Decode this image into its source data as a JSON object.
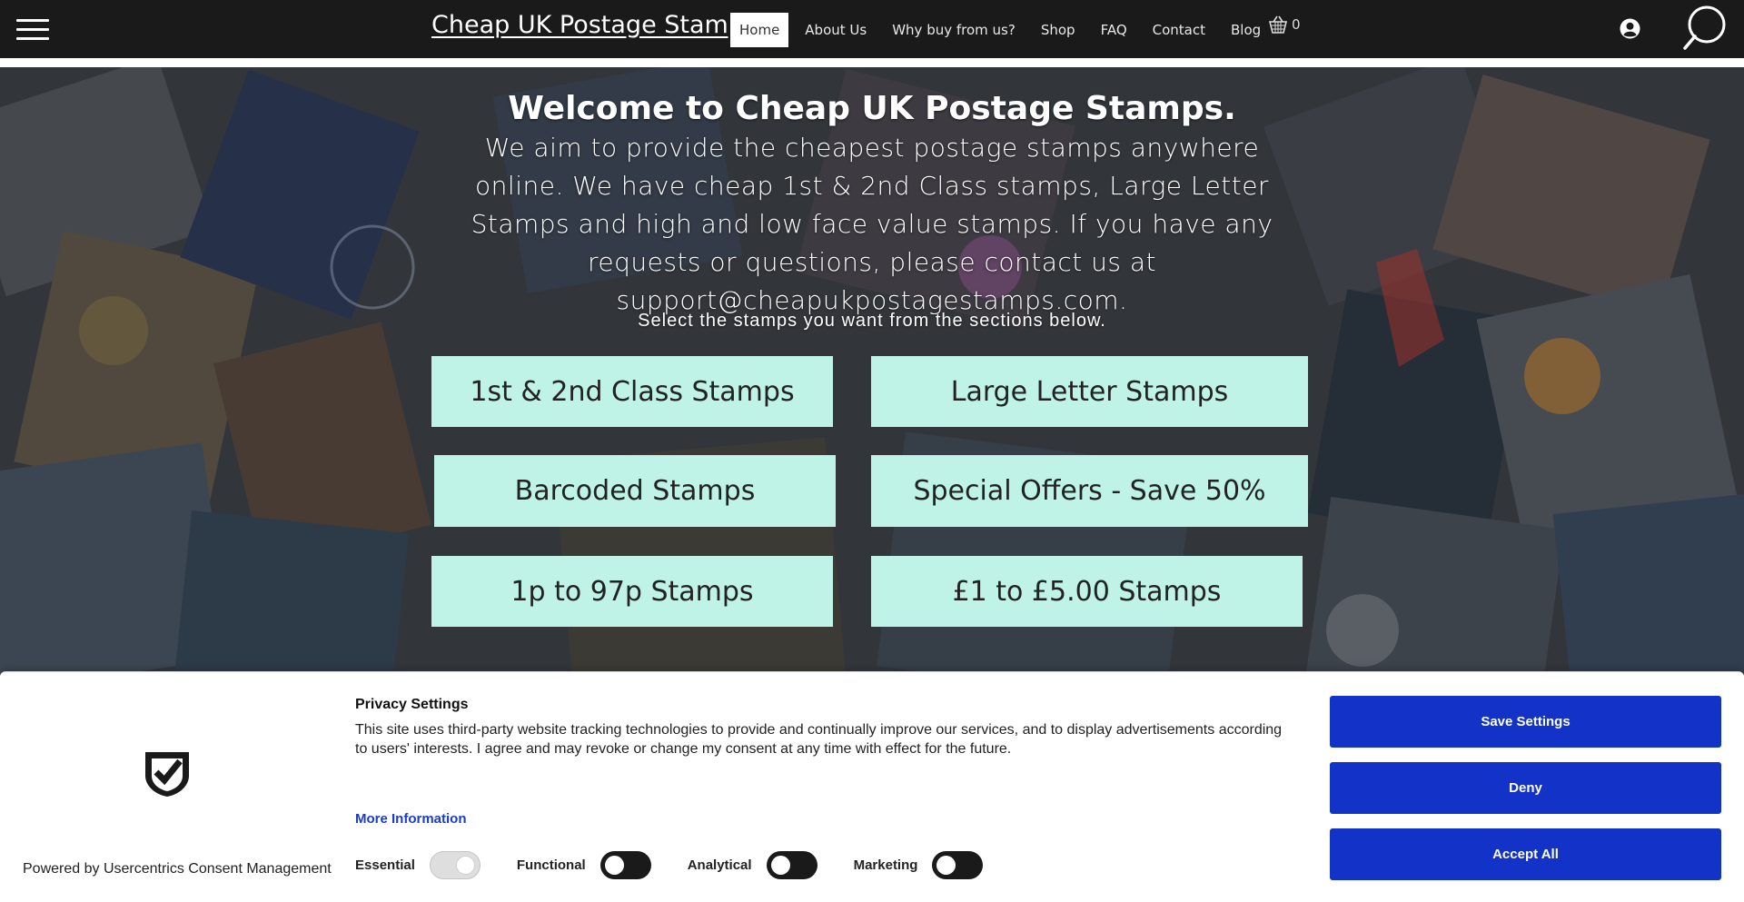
{
  "header": {
    "site_title": "Cheap UK Postage Stamps",
    "nav": [
      "Home",
      "About Us",
      "Why buy from us?",
      "Shop",
      "FAQ",
      "Contact",
      "Blog"
    ],
    "active_nav": "Home",
    "cart_count": "0",
    "icons": [
      "menu-icon",
      "cart-icon",
      "user-icon",
      "search-icon"
    ]
  },
  "hero": {
    "title": "Welcome to Cheap UK Postage Stamps.",
    "paragraph": "We aim to provide the cheapest postage stamps anywhere online. We have cheap 1st & 2nd Class stamps, Large Letter Stamps and high and low face value stamps. If you have any requests or questions, please contact us at support@cheapukpostagestamps.com.",
    "select_text": "Select the stamps you want from the sections below.",
    "tiles": [
      "1st & 2nd Class Stamps",
      "Large Letter Stamps",
      "Barcoded Stamps",
      "Special Offers - Save 50%",
      "1p to 97p Stamps",
      "£1 to £5.00 Stamps"
    ],
    "tile_color": "#bff3e8"
  },
  "consent": {
    "title": "Privacy Settings",
    "description": "This site uses third-party website tracking technologies to provide and continually improve our services, and to display advertisements according to users' interests. I agree and may revoke or change my consent at any time with effect for the future.",
    "more_info": "More Information",
    "powered_by": "Powered by Usercentrics Consent Management",
    "toggles": [
      {
        "label": "Essential",
        "state": "on-locked"
      },
      {
        "label": "Functional",
        "state": "off"
      },
      {
        "label": "Analytical",
        "state": "off"
      },
      {
        "label": "Marketing",
        "state": "off"
      }
    ],
    "buttons": {
      "save": "Save Settings",
      "deny": "Deny",
      "accept": "Accept All"
    },
    "button_color": "#1232c8"
  }
}
